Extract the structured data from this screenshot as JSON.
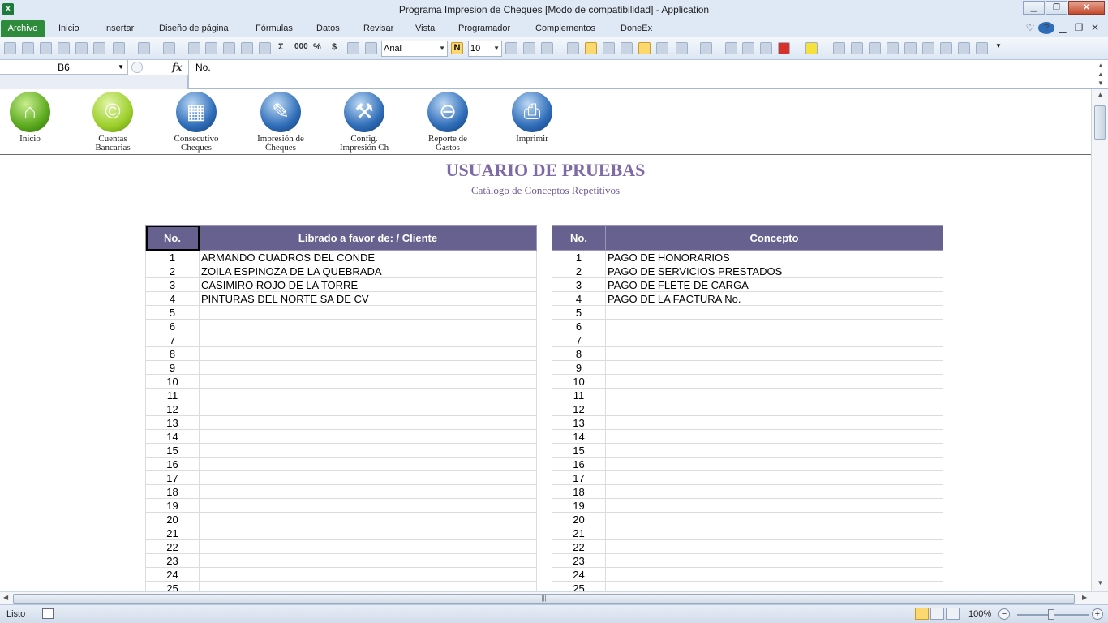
{
  "window": {
    "title": "Programa Impresion de Cheques  [Modo de compatibilidad]  -  Application",
    "minimize": "▁",
    "maximize": "❐",
    "close": "✕"
  },
  "menu": {
    "tabs": [
      "Archivo",
      "Inicio",
      "Insertar",
      "Diseño de página",
      "Fórmulas",
      "Datos",
      "Revisar",
      "Vista",
      "Programador",
      "Complementos",
      "DoneEx"
    ]
  },
  "toolbar": {
    "font_name": "Arial",
    "font_size": "10",
    "bold_label": "N",
    "sigma": "Σ",
    "thousands": "000",
    "percent": "%",
    "currency": "$"
  },
  "formula_bar": {
    "cell_ref": "B6",
    "fx": "fx",
    "value": "No."
  },
  "nav_buttons": [
    {
      "icon": "house-icon",
      "label": "Inicio"
    },
    {
      "icon": "copyright-icon",
      "label": "Cuentas Bancarias"
    },
    {
      "icon": "calculator-icon",
      "label": "Consecutivo Cheques"
    },
    {
      "icon": "brush-icon",
      "label": "Impresión de Cheques"
    },
    {
      "icon": "tools-icon",
      "label": "Config. Impresión Ch"
    },
    {
      "icon": "minus-icon",
      "label": "Reporte de Gastos"
    },
    {
      "icon": "printer-icon",
      "label": "Imprimir"
    }
  ],
  "sheet": {
    "heading": "USUARIO DE PRUEBAS",
    "subheading": "Catálogo de Conceptos Repetitivos",
    "clients_table": {
      "headers": [
        "No.",
        "Librado a favor de: / Cliente"
      ],
      "rows": [
        {
          "no": "1",
          "text": "ARMANDO CUADROS DEL CONDE"
        },
        {
          "no": "2",
          "text": "ZOILA ESPINOZA DE LA QUEBRADA"
        },
        {
          "no": "3",
          "text": "CASIMIRO ROJO DE LA TORRE"
        },
        {
          "no": "4",
          "text": "PINTURAS DEL NORTE SA DE CV"
        },
        {
          "no": "5",
          "text": ""
        },
        {
          "no": "6",
          "text": ""
        },
        {
          "no": "7",
          "text": ""
        },
        {
          "no": "8",
          "text": ""
        },
        {
          "no": "9",
          "text": ""
        },
        {
          "no": "10",
          "text": ""
        },
        {
          "no": "11",
          "text": ""
        },
        {
          "no": "12",
          "text": ""
        },
        {
          "no": "13",
          "text": ""
        },
        {
          "no": "14",
          "text": ""
        },
        {
          "no": "15",
          "text": ""
        },
        {
          "no": "16",
          "text": ""
        },
        {
          "no": "17",
          "text": ""
        },
        {
          "no": "18",
          "text": ""
        },
        {
          "no": "19",
          "text": ""
        },
        {
          "no": "20",
          "text": ""
        },
        {
          "no": "21",
          "text": ""
        },
        {
          "no": "22",
          "text": ""
        },
        {
          "no": "23",
          "text": ""
        },
        {
          "no": "24",
          "text": ""
        },
        {
          "no": "25",
          "text": ""
        }
      ]
    },
    "concepts_table": {
      "headers": [
        "No.",
        "Concepto"
      ],
      "rows": [
        {
          "no": "1",
          "text": "PAGO DE HONORARIOS"
        },
        {
          "no": "2",
          "text": "PAGO DE SERVICIOS PRESTADOS"
        },
        {
          "no": "3",
          "text": "PAGO DE FLETE DE CARGA"
        },
        {
          "no": "4",
          "text": "PAGO DE LA FACTURA No."
        },
        {
          "no": "5",
          "text": ""
        },
        {
          "no": "6",
          "text": ""
        },
        {
          "no": "7",
          "text": ""
        },
        {
          "no": "8",
          "text": ""
        },
        {
          "no": "9",
          "text": ""
        },
        {
          "no": "10",
          "text": ""
        },
        {
          "no": "11",
          "text": ""
        },
        {
          "no": "12",
          "text": ""
        },
        {
          "no": "13",
          "text": ""
        },
        {
          "no": "14",
          "text": ""
        },
        {
          "no": "15",
          "text": ""
        },
        {
          "no": "16",
          "text": ""
        },
        {
          "no": "17",
          "text": ""
        },
        {
          "no": "18",
          "text": ""
        },
        {
          "no": "19",
          "text": ""
        },
        {
          "no": "20",
          "text": ""
        },
        {
          "no": "21",
          "text": ""
        },
        {
          "no": "22",
          "text": ""
        },
        {
          "no": "23",
          "text": ""
        },
        {
          "no": "24",
          "text": ""
        },
        {
          "no": "25",
          "text": ""
        }
      ]
    }
  },
  "status_bar": {
    "status": "Listo",
    "zoom": "100%",
    "zoom_out": "−",
    "zoom_in": "+"
  },
  "colors": {
    "header_fill": "#67618f",
    "heading_text": "#7e6aa6",
    "archivo_tab": "#2e8b3c"
  }
}
